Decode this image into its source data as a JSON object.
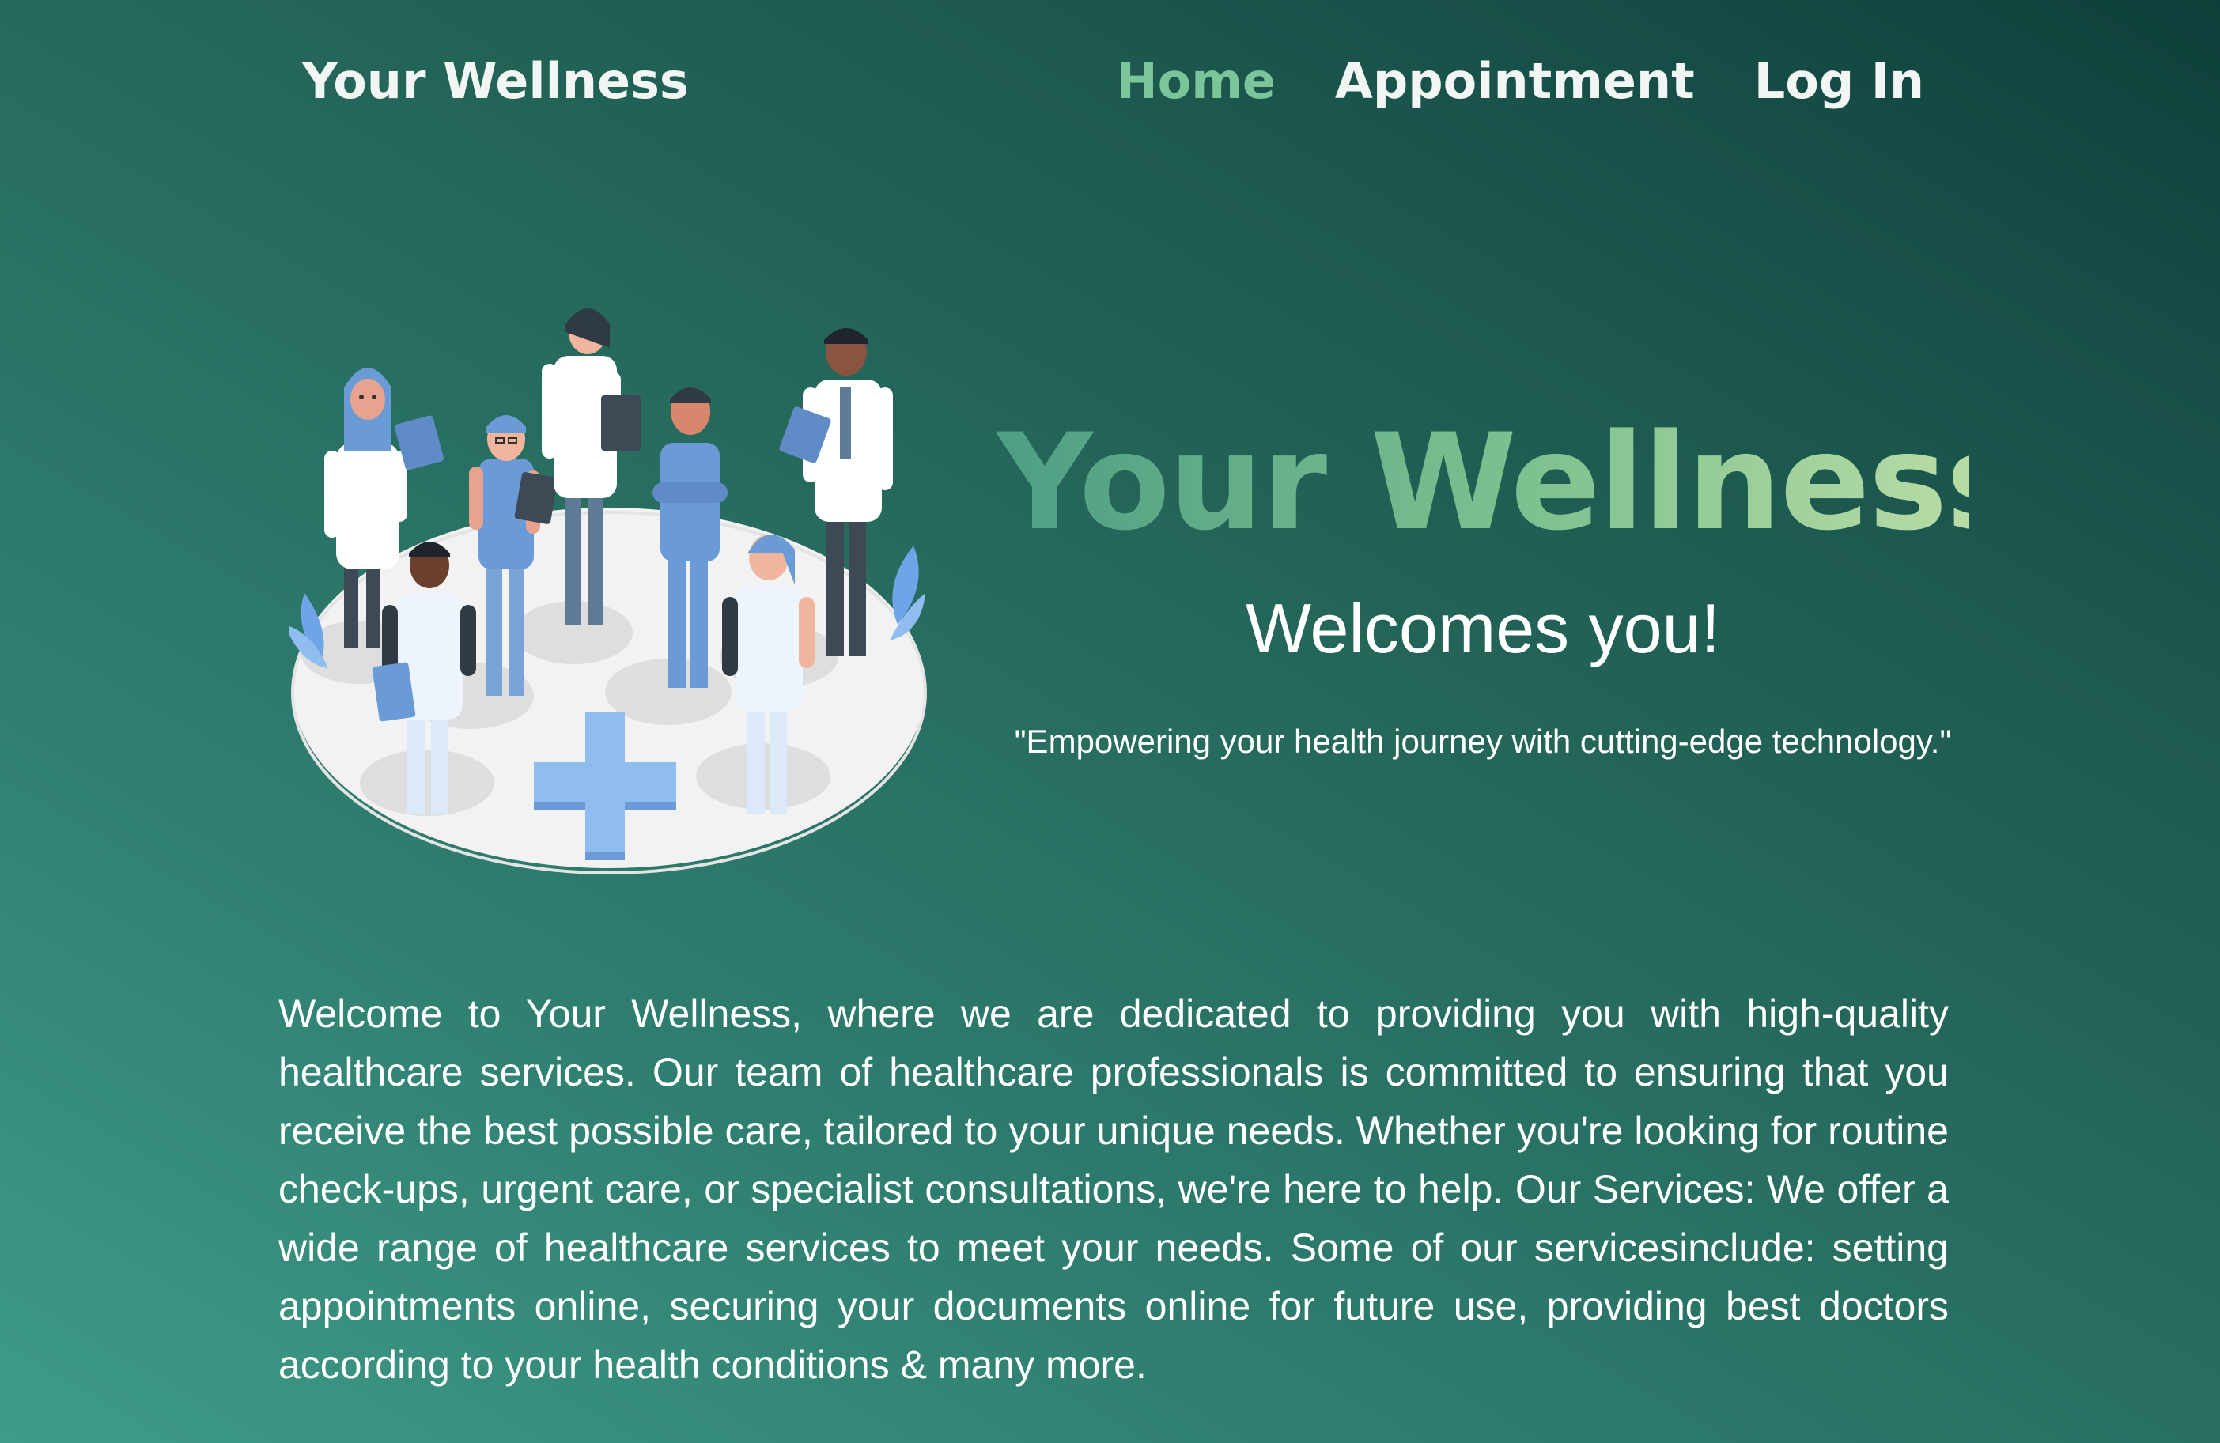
{
  "nav": {
    "brand": "Your Wellness",
    "links": [
      {
        "label": "Home",
        "active": true
      },
      {
        "label": "Appointment",
        "active": false
      },
      {
        "label": "Log In",
        "active": false
      }
    ]
  },
  "hero": {
    "title": "Your Wellness",
    "subtitle": "Welcomes you!",
    "tagline": "\"Empowering your health journey with cutting-edge technology.\"",
    "illustration": "medical-team-illustration"
  },
  "about": {
    "text": "Welcome to Your Wellness, where we are dedicated to providing you with high-quality healthcare services. Our team of healthcare professionals is committed to ensuring that you receive the best possible care, tailored to your unique needs. Whether you're looking for routine check-ups, urgent care, or specialist consultations, we're here to help. Our Services: We offer a wide range of healthcare services to meet your needs. Some of our servicesinclude: setting appointments online, securing your documents online for future use, providing best doctors according to your health conditions & many more."
  },
  "colors": {
    "background_start": "#3f9b88",
    "background_end": "#0f3f3a",
    "active_link": "#7cc59a",
    "title_gradient_start": "#4f9e84",
    "title_gradient_end": "#b9dca5"
  }
}
